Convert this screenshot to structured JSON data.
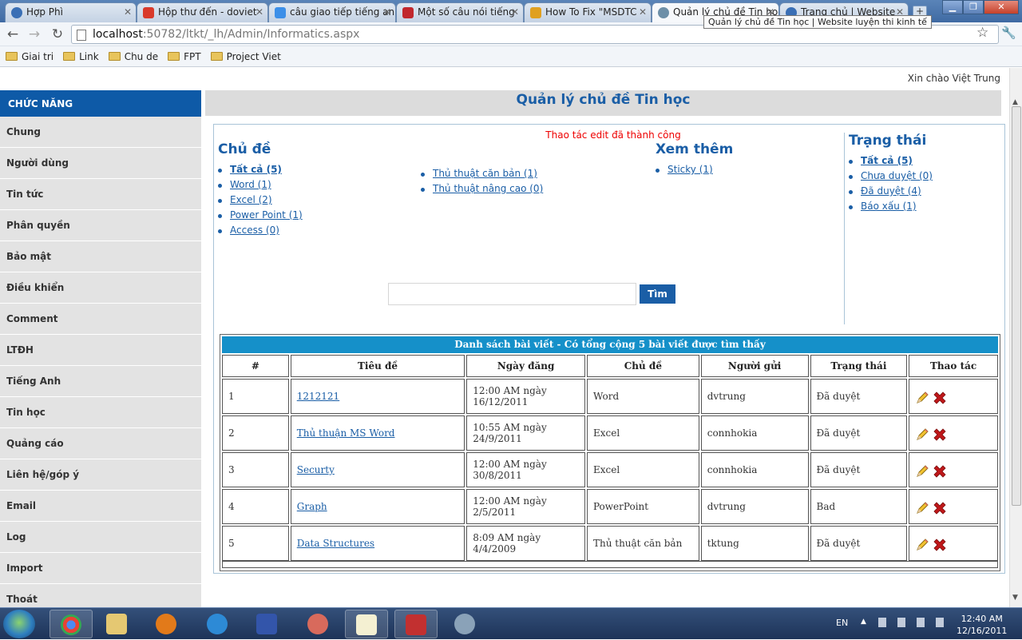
{
  "browser": {
    "tabs": [
      {
        "title": "Hợp Phì",
        "icon_color": "#3a6fb5"
      },
      {
        "title": "Hộp thư đến - doviet",
        "icon_color": "#d93a2b"
      },
      {
        "title": "câu giao tiếp tiếng anh",
        "icon_color": "#3c8fe8"
      },
      {
        "title": "Một số câu nói tiếng",
        "icon_color": "#c1272d"
      },
      {
        "title": "How To Fix \"MSDTC",
        "icon_color": "#e0a020"
      },
      {
        "title": "Quản lý chủ đề Tin học",
        "icon_color": "#6d8fa8",
        "active": true
      },
      {
        "title": "Trang chủ | Website",
        "icon_color": "#3a6fb5"
      }
    ],
    "new_tab_label": "+",
    "tooltip": "Quản lý chủ đề Tin học | Website luyện thi kinh tế",
    "url_host": "localhost",
    "url_rest": ":50782/ltkt/_lh/Admin/Informatics.aspx",
    "bookmarks": [
      "Giai tri",
      "Link",
      "Chu de",
      "FPT",
      "Project Viet"
    ]
  },
  "page": {
    "greeting": "Xin chào Việt Trung",
    "title": "Quản lý chủ đề Tin học",
    "message": "Thao tác edit đã thành công",
    "search_button": "Tìm",
    "search_value": ""
  },
  "sidebar": {
    "header": "CHỨC NĂNG",
    "items": [
      "Chung",
      "Người dùng",
      "Tin tức",
      "Phân quyền",
      "Bảo mật",
      "Điều khiển",
      "Comment",
      "LTĐH",
      "Tiếng Anh",
      "Tin học",
      "Quảng cáo",
      "Liên hệ/góp ý",
      "Email",
      "Log",
      "Import",
      "Thoát"
    ]
  },
  "topics": {
    "heading": "Chủ đề",
    "col1": [
      "Tất cả (5)",
      "Word (1)",
      "Excel (2)",
      "Power Point (1)",
      "Access (0)"
    ],
    "col2": [
      "Thủ thuật căn bản (1)",
      "Thủ thuật nâng cao (0)"
    ]
  },
  "more": {
    "heading": "Xem thêm",
    "items": [
      "Sticky (1)"
    ]
  },
  "status": {
    "heading": "Trạng thái",
    "items": [
      "Tất cả (5)",
      "Chưa duyệt (0)",
      "Đã duyệt (4)",
      "Báo xấu (1)"
    ]
  },
  "table": {
    "caption": "Danh sách bài viết -  Có tổng cộng 5 bài viết được tìm thấy",
    "headers": [
      "#",
      "Tiêu đề",
      "Ngày đăng",
      "Chủ đề",
      "Người gửi",
      "Trạng thái",
      "Thao tác"
    ],
    "rows": [
      {
        "num": "1",
        "title": "1212121",
        "date": "12:00 AM ngày 16/12/2011",
        "topic": "Word",
        "sender": "dvtrung",
        "status": "Đã duyệt"
      },
      {
        "num": "2",
        "title": "Thủ thuận MS Word",
        "date": "10:55 AM ngày 24/9/2011",
        "topic": "Excel",
        "sender": "connhokia",
        "status": "Đã duyệt"
      },
      {
        "num": "3",
        "title": "Securty",
        "date": "12:00 AM ngày 30/8/2011",
        "topic": "Excel",
        "sender": "connhokia",
        "status": "Đã duyệt"
      },
      {
        "num": "4",
        "title": "Graph",
        "date": "12:00 AM ngày 2/5/2011",
        "topic": "PowerPoint",
        "sender": "dvtrung",
        "status": "Bad"
      },
      {
        "num": "5",
        "title": "Data Structures",
        "date": "8:09 AM ngày 4/4/2009",
        "topic": "Thủ thuật căn bản",
        "sender": "tktung",
        "status": "Đã duyệt"
      }
    ]
  },
  "taskbar": {
    "apps": [
      "chrome",
      "explorer",
      "media-player",
      "internet-explorer",
      "floppy-save",
      "paint",
      "notepad",
      "toolbox",
      "turtle"
    ],
    "lang": "EN",
    "time": "12:40 AM",
    "date": "12/16/2011"
  },
  "colors": {
    "accent": "#1a5ea6",
    "sidebar_header": "#0e5aa7",
    "table_caption": "#1590c9",
    "message": "#e00000"
  }
}
